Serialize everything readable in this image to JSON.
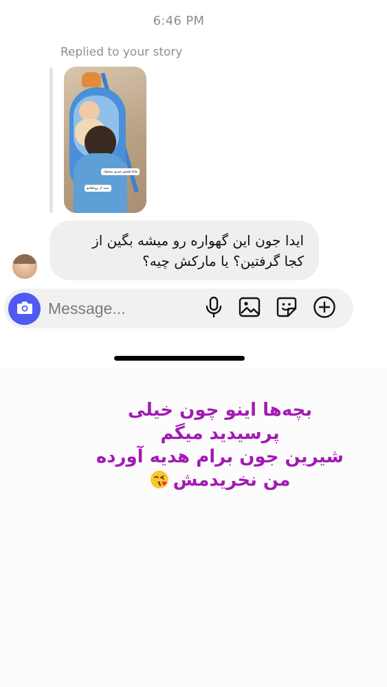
{
  "status": {
    "time": "6:46 PM"
  },
  "thread": {
    "reply_label": "Replied to your story",
    "story_captions": [
      "ماما همش میری میخواد",
      "ببینه از رو‌یاهامو"
    ],
    "message_line1": "ایدا جون این گهواره رو میشه بگین از",
    "message_line2": "کجا گرفتین؟ یا مارکش چیه؟"
  },
  "composer": {
    "placeholder": "Message...",
    "value": "",
    "icons": [
      "camera-icon",
      "microphone-icon",
      "image-icon",
      "sticker-icon",
      "plus-icon"
    ]
  },
  "overlay": {
    "line1": "بچه‌ها اینو چون خیلی",
    "line2": "پرسیدید میگم",
    "line3": "شیرین جون برام هدیه آورده",
    "line4": "من نخریدمش",
    "color": "#a31ab3"
  },
  "colors": {
    "accent": "#4f5bf0",
    "bubble": "#efefef"
  }
}
